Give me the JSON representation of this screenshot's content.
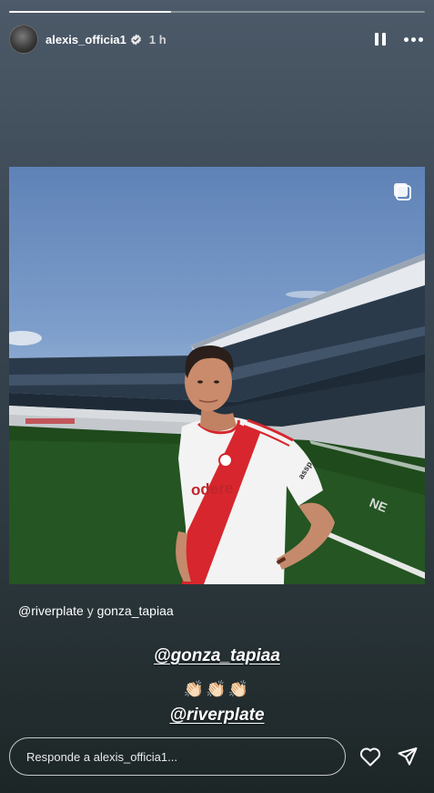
{
  "story": {
    "progress_fraction": 0.39,
    "username": "alexis_officia1",
    "time_ago": "1 h"
  },
  "caption": {
    "handle_1": "@riverplate",
    "separator": "y",
    "handle_2": "gonza_tapiaa"
  },
  "photo": {
    "shirt_sponsor": "odere",
    "sleeve_sponsor": "assp"
  },
  "stickers": {
    "mention_1": "@gonza_tapiaa",
    "emoji": "👏🏻👏🏻👏🏻",
    "mention_2": "@riverplate"
  },
  "reply": {
    "placeholder": "Responde a alexis_officia1..."
  },
  "icons": {
    "avatar": "lion-avatar",
    "verified": "verified-badge-icon",
    "pause": "pause-icon",
    "more": "more-options-icon",
    "carousel": "carousel-icon",
    "like": "heart-icon",
    "send": "send-icon"
  },
  "colors": {
    "river_red": "#d7262d",
    "verified_blue": "#3897f0"
  }
}
